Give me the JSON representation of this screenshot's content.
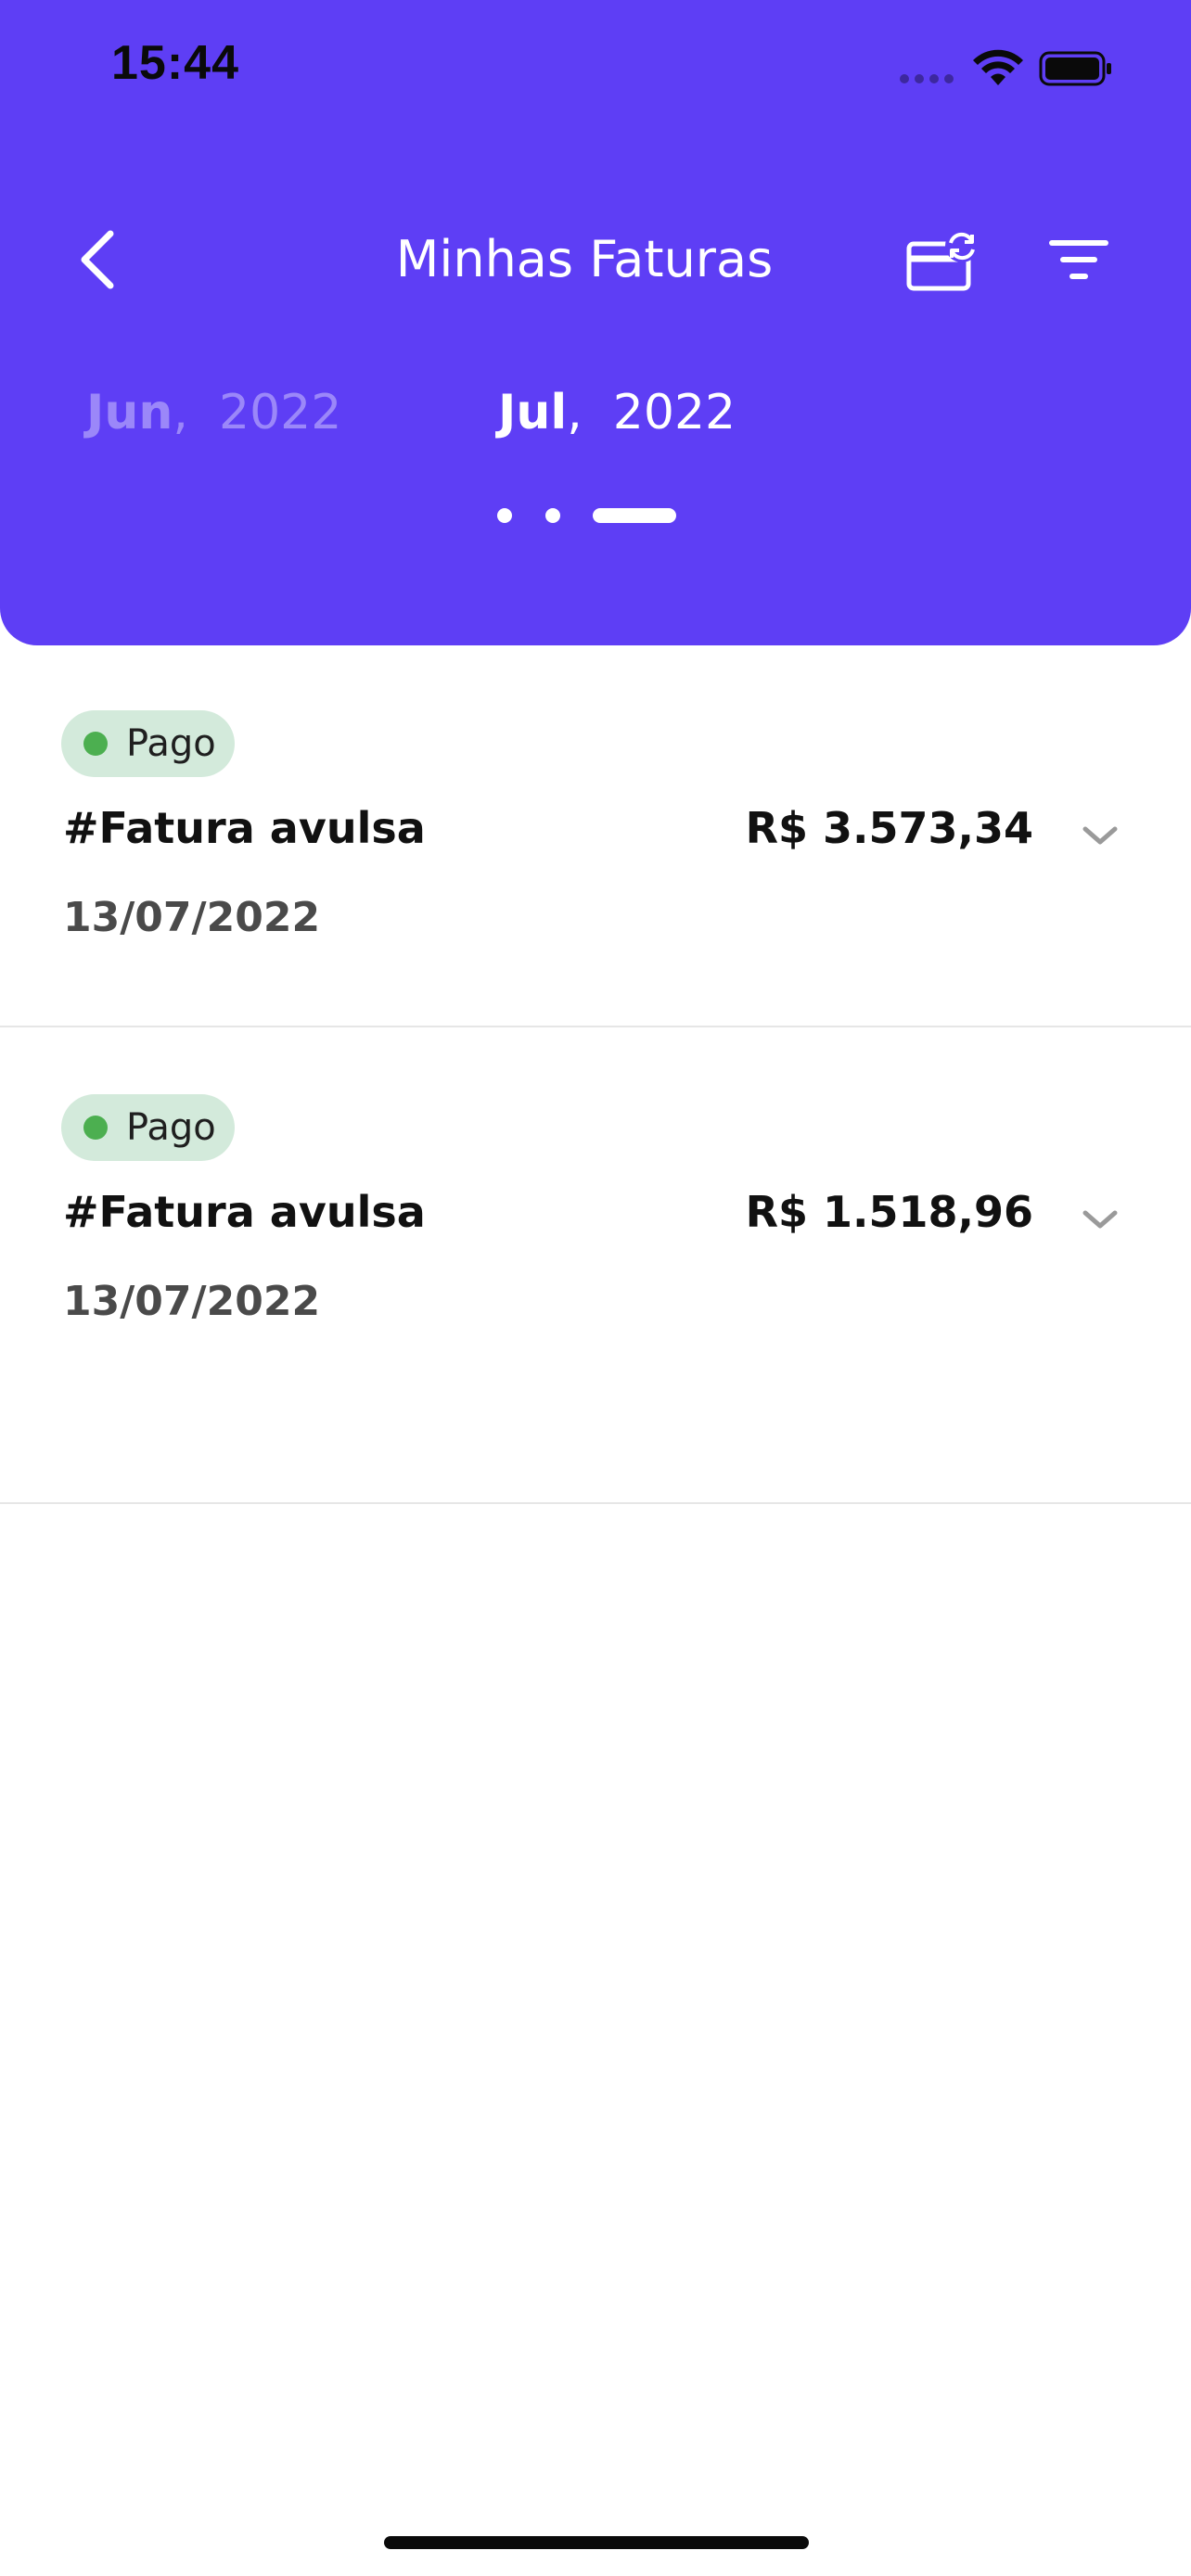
{
  "status_bar": {
    "time": "15:44"
  },
  "header": {
    "title": "Minhas Faturas",
    "background_color": "#5e3ef5",
    "icons": {
      "back": "chevron-left-icon",
      "card_sync": "credit-card-sync-icon",
      "filter": "filter-icon"
    }
  },
  "month_carousel": {
    "previous": {
      "month": "Jun",
      "separator": ",",
      "year": "2022"
    },
    "current": {
      "month": "Jul",
      "separator": ",",
      "year": "2022"
    },
    "page_count": 3,
    "active_page": 3
  },
  "invoices": [
    {
      "status": "Pago",
      "status_color": "#4caf50",
      "title": "#Fatura avulsa",
      "amount": "R$ 3.573,34",
      "date": "13/07/2022"
    },
    {
      "status": "Pago",
      "status_color": "#4caf50",
      "title": "#Fatura avulsa",
      "amount": "R$ 1.518,96",
      "date": "13/07/2022"
    }
  ]
}
